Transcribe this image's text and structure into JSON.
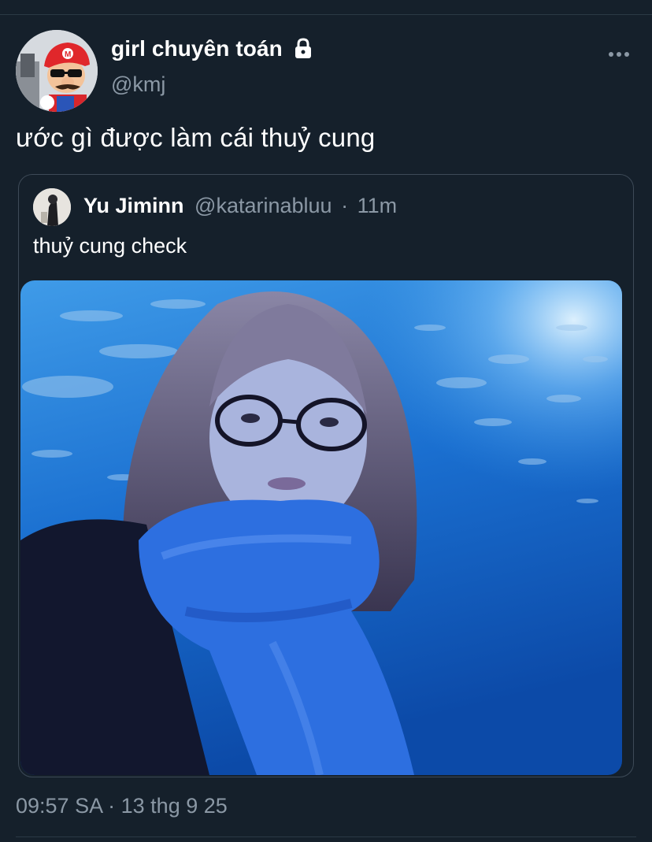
{
  "tweet": {
    "display_name": "girl chuyên toán",
    "handle": "@kmj",
    "text": "ước gì được làm cái thuỷ cung",
    "timestamp": "09:57 SA",
    "separator": "·",
    "date": "13 thg 9 25"
  },
  "quote": {
    "display_name": "Yu Jiminn",
    "handle": "@katarinabluu",
    "separator": "·",
    "time": "11m",
    "text": "thuỷ cung check"
  },
  "icons": {
    "lock": "lock-icon",
    "more": "more-icon"
  },
  "colors": {
    "background": "#15202b",
    "secondary_text": "#8b98a5",
    "border": "#3d4a57",
    "aquarium_blue": "#1a6fd0"
  }
}
